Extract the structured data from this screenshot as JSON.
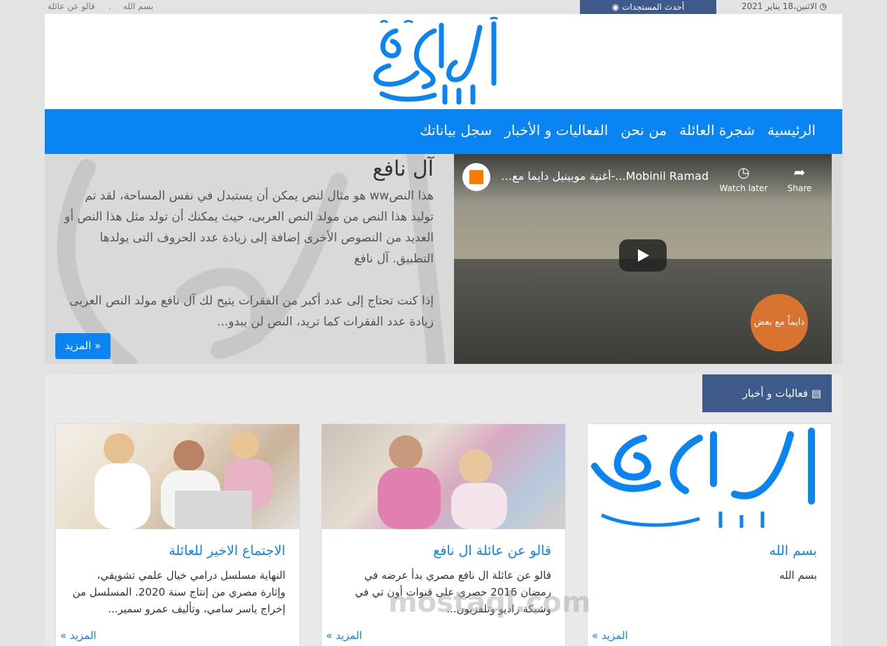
{
  "topbar": {
    "date": "الاثنين،18 يناير 2021",
    "latest": "أحدث المستجدات",
    "links": [
      "قالو عن عائلة",
      ".",
      "بسم الله"
    ]
  },
  "nav": {
    "items": [
      "الرئيسية",
      "شجرة العائلة",
      "من نحن",
      "الفعاليات و الأخبار",
      "سجل بياناتك"
    ]
  },
  "hero": {
    "title": "آل نافع",
    "paragraph1": "هذا النصww هو مثال لنص يمكن أن يستبدل في نفس المساحة، لقد تم توليد هذا النص من مولد النص العربى، حيث يمكنك أن تولد مثل هذا النص أو العديد من النصوص الأخرى إضافة إلى زيادة عدد الحروف التى يولدها التطبيق. آل نافع",
    "paragraph2": "إذا كنت تحتاج إلى عدد أكبر من الفقرات يتيح لك آل نافع مولد النص العربى زيادة عدد الفقرات كما تريد، النص لن يبدو...",
    "more": "المزيد »"
  },
  "video": {
    "title": "Mobinil Ramad...-أغنية موبينيل دايما مع بعض",
    "watch_later": "Watch later",
    "share": "Share",
    "badge": "دايماً مع بعض"
  },
  "section": {
    "title": "فعاليات و أخبار",
    "cards": [
      {
        "title": "بسم الله",
        "text": "بسم الله",
        "more": "المزيد »"
      },
      {
        "title": "قالو عن عائلة ال نافع",
        "text": "قالو عن عائلة ال نافع مصري بدأ عرضه في رمضان 2016 حصري على قنوات أون تي في وشبكة راديو وتلفزيون...",
        "more": "المزيد »"
      },
      {
        "title": "الاجتماع الاخير للعائلة",
        "text": "النهاية مسلسل درامي خيال علمي تشويقي، وإثارة مصري من إنتاج سنة 2020. المسلسل من إخراج ياسر سامي، وتأليف عمرو سمير...",
        "more": "المزيد »"
      }
    ]
  },
  "watermark": "mostaql.com",
  "colors": {
    "primary": "#0b84f3",
    "secondary": "#3d5a8a"
  }
}
